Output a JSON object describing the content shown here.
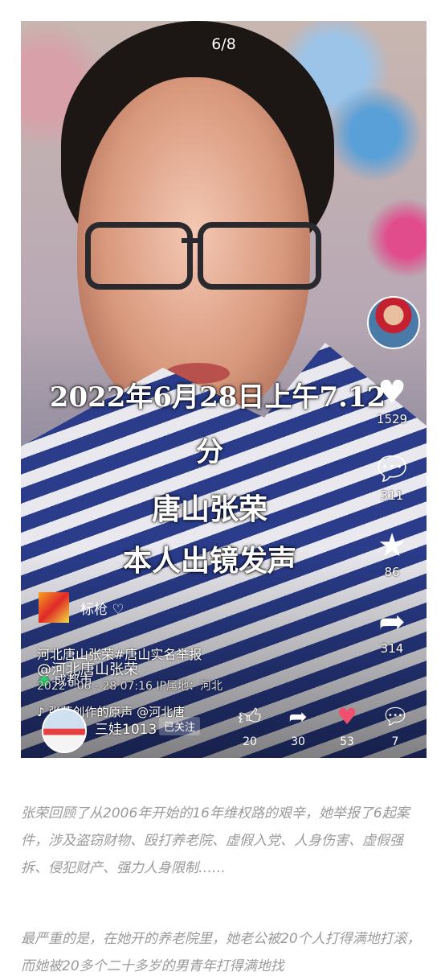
{
  "pager": "6/8",
  "caption_lines": [
    "2022年6月28日上午7.12",
    "分",
    "唐山张荣",
    "本人出镜发声"
  ],
  "rail": {
    "like_count": "1529",
    "comment_count": "311",
    "star_count": "86",
    "share_count": "314"
  },
  "author": {
    "name": "标枪 ♡"
  },
  "desc": {
    "title": "河北唐山张荣#唐山实名举报",
    "mention": "@河北唐山张荣",
    "location": "成都市",
    "meta": "2022 - 06 - 28 07:16  IP属地：河北",
    "music": "张荣创作的原声    @河北唐"
  },
  "bottom": {
    "user": "三娃1013",
    "follow_label": "已关注",
    "like": "20",
    "share": "30",
    "heart": "53",
    "comment": "7"
  },
  "article": {
    "para1": "张荣回顾了从2006年开始的16年维权路的艰辛，她举报了6起案件，涉及盗窃财物、殴打养老院、虚假入党、人身伤害、虚假强拆、侵犯财产、强力人身限制……",
    "para2": "最严重的是，在她开的养老院里，她老公被20个人打得满地打滚，而她被20多个二十多岁的男青年打得满地找"
  },
  "colors": {
    "heart": "#f0506e",
    "follow_bg": "rgba(255,255,255,0.25)"
  }
}
